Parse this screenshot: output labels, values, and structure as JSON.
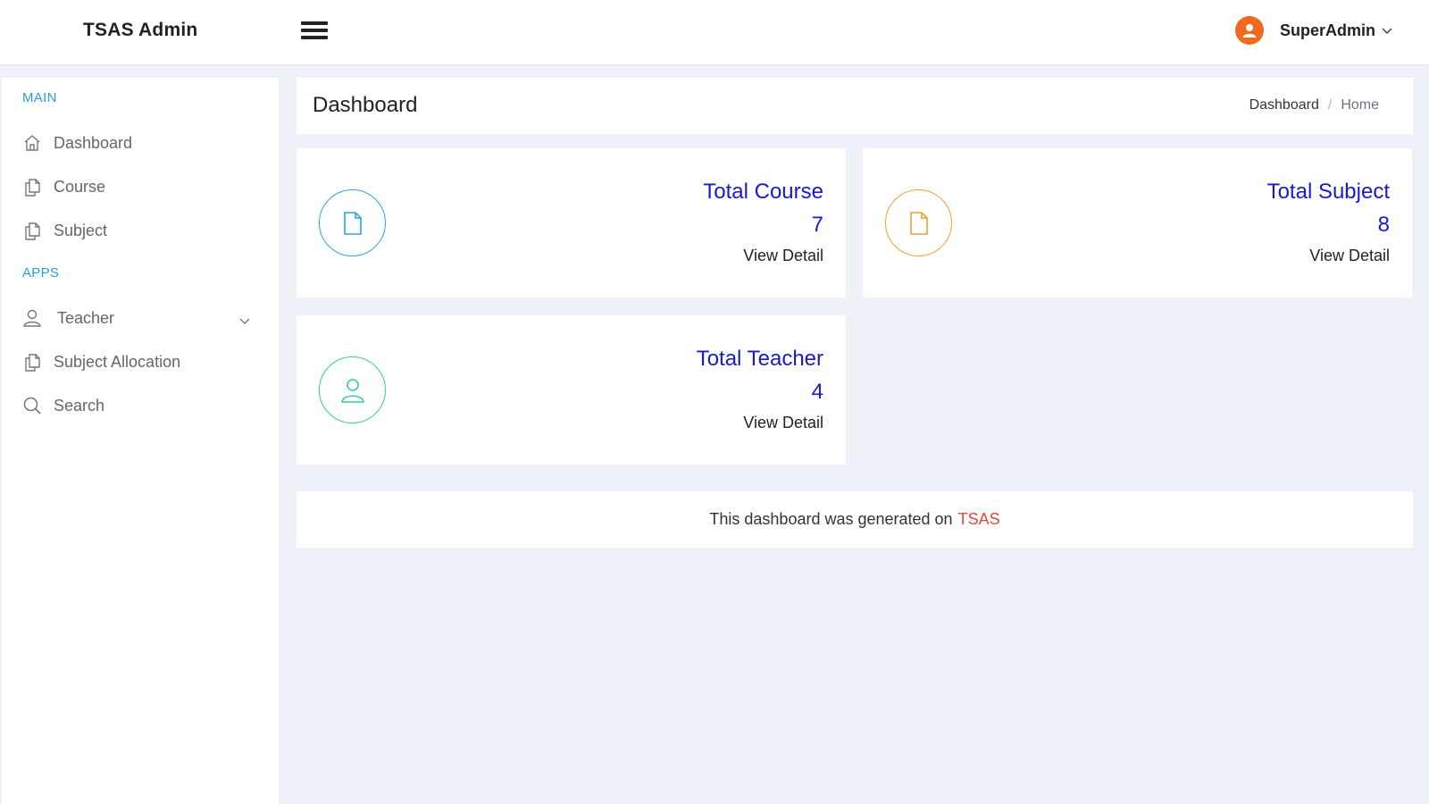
{
  "header": {
    "brand": "TSAS Admin",
    "user_name": "SuperAdmin"
  },
  "sidebar": {
    "main_heading": "MAIN",
    "apps_heading": "APPS",
    "items": [
      {
        "label": "Dashboard",
        "icon": "home-icon"
      },
      {
        "label": "Course",
        "icon": "documents-icon"
      },
      {
        "label": "Subject",
        "icon": "documents-icon"
      },
      {
        "label": "Teacher",
        "icon": "user-icon"
      },
      {
        "label": "Subject Allocation",
        "icon": "documents-icon"
      },
      {
        "label": "Search",
        "icon": "search-icon"
      }
    ]
  },
  "page": {
    "title": "Dashboard",
    "breadcrumb": [
      "Dashboard",
      "/",
      "Home"
    ]
  },
  "cards": [
    {
      "label": "Total Course",
      "value": "7",
      "link": "View Detail",
      "color": "#2aa8d8",
      "icon": "file-icon"
    },
    {
      "label": "Total Subject",
      "value": "8",
      "link": "View Detail",
      "color": "#f0a030",
      "icon": "file-icon"
    },
    {
      "label": "Total Teacher",
      "value": "4",
      "link": "View Detail",
      "color": "#2fcfa0",
      "icon": "user-icon"
    }
  ],
  "footer": {
    "text": "This dashboard was generated on",
    "brand": "TSAS"
  },
  "colors": {
    "accent_text": "#1a1acd",
    "heading_blue": "#2a9fd6",
    "avatar": "#f06a1d",
    "footer_brand": "#e04a3a",
    "background": "#eef1f7"
  }
}
